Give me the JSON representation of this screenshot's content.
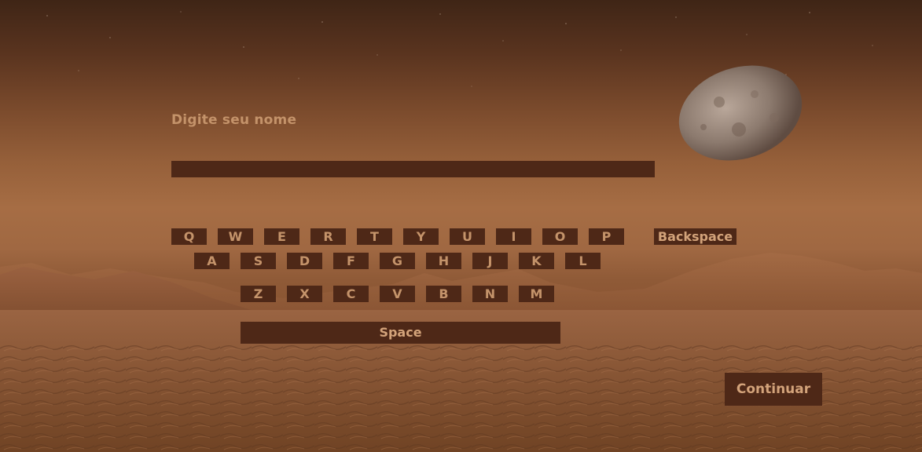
{
  "form": {
    "prompt_label": "Digite seu nome",
    "name_value": ""
  },
  "keyboard": {
    "row1": [
      "Q",
      "W",
      "E",
      "R",
      "T",
      "Y",
      "U",
      "I",
      "O",
      "P"
    ],
    "row2": [
      "A",
      "S",
      "D",
      "F",
      "G",
      "H",
      "J",
      "K",
      "L"
    ],
    "row3": [
      "Z",
      "X",
      "C",
      "V",
      "B",
      "N",
      "M"
    ],
    "backspace_label": "Backspace",
    "space_label": "Space"
  },
  "actions": {
    "continue_label": "Continuar"
  },
  "colors": {
    "button_bg": "#4e2817",
    "label_text": "#c4936a",
    "sky_top": "#3f2516",
    "horizon": "#a66d44"
  },
  "icons": [
    "moon-icon",
    "mountains-icon",
    "stars-icon"
  ]
}
